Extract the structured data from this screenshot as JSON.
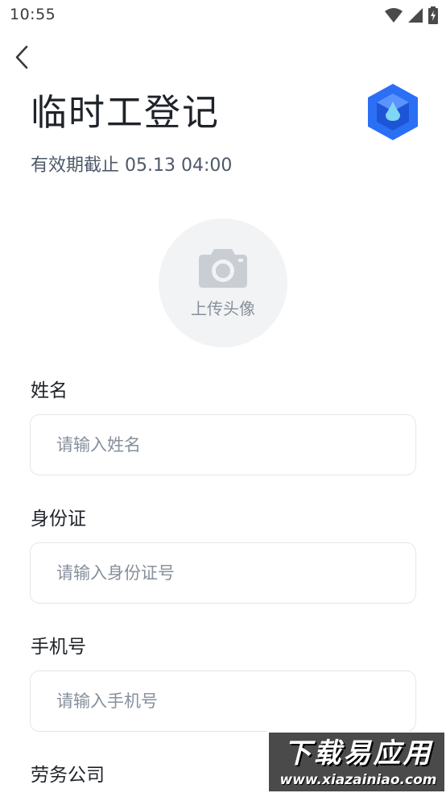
{
  "status_bar": {
    "time": "10:55",
    "icons": [
      "wifi-icon",
      "signal-icon",
      "battery-charging-icon"
    ]
  },
  "header": {
    "back_icon": "chevron-left-icon",
    "title": "临时工登记",
    "logo_icon": "cube-logo-icon",
    "validity": "有效期截止 05.13 04:00"
  },
  "avatar": {
    "icon": "camera-icon",
    "label": "上传头像"
  },
  "form": {
    "fields": [
      {
        "label": "姓名",
        "placeholder": "请输入姓名",
        "value": ""
      },
      {
        "label": "身份证",
        "placeholder": "请输入身份证号",
        "value": ""
      },
      {
        "label": "手机号",
        "placeholder": "请输入手机号",
        "value": ""
      },
      {
        "label": "劳务公司"
      }
    ]
  },
  "watermark": {
    "main": "下载易应用",
    "sub": "www.xiazainiao.com"
  },
  "colors": {
    "brand_blue": "#2b6ff5",
    "logo_accent": "#7fd6f5",
    "placeholder": "#86909c",
    "border": "#e5e6eb",
    "avatar_bg": "#f2f3f5"
  }
}
